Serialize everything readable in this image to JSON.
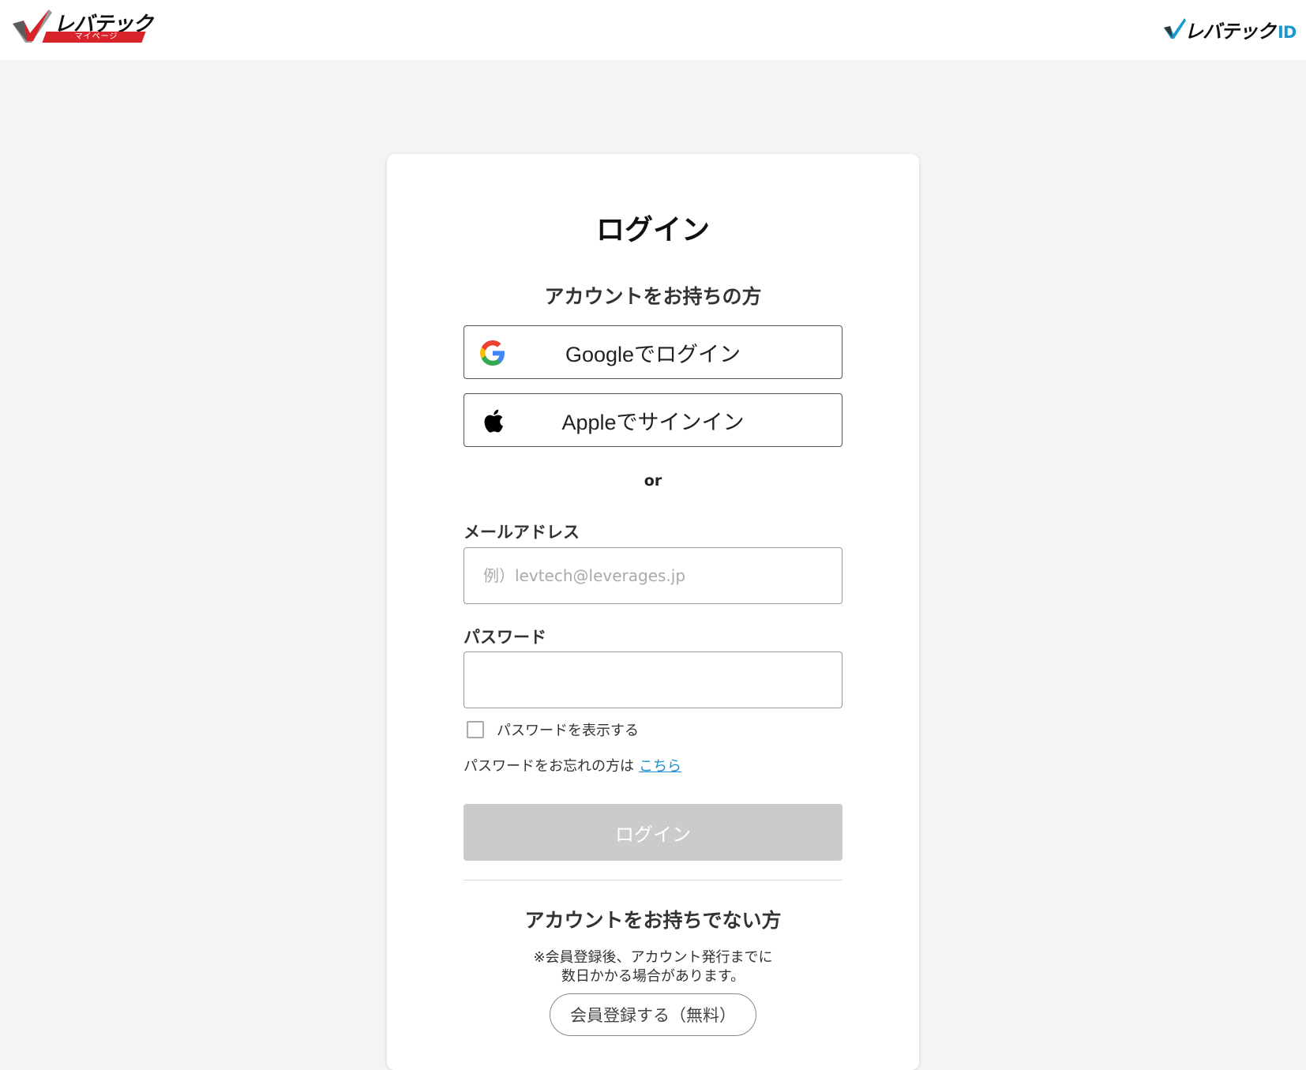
{
  "header": {
    "left_logo": {
      "wordmark": "レバテック",
      "band_text": "マイページ",
      "accent_color": "#d9232a"
    },
    "right_logo": {
      "wordmark": "レバテック",
      "suffix": "ID",
      "accent_color": "#1a9bd0"
    }
  },
  "login": {
    "title": "ログイン",
    "existing_heading": "アカウントをお持ちの方",
    "google_label": "Googleでログイン",
    "google_icon": "google-g-icon",
    "apple_label": "Appleでサインイン",
    "apple_icon": "apple-icon",
    "or": "or",
    "email": {
      "label": "メールアドレス",
      "placeholder": "例）levtech@leverages.jp",
      "value": ""
    },
    "password": {
      "label": "パスワード",
      "value": ""
    },
    "show_password_label": "パスワードを表示する",
    "show_password_checked": false,
    "forgot_text": "パスワードをお忘れの方は",
    "forgot_link": "こちら",
    "submit_label": "ログイン",
    "submit_disabled": true
  },
  "register": {
    "heading": "アカウントをお持ちでない方",
    "note_line1": "※会員登録後、アカウント発行までに",
    "note_line2": "数日かかる場合があります。",
    "button_label": "会員登録する（無料）"
  },
  "colors": {
    "page_bg": "#f4f4f4",
    "card_bg": "#ffffff",
    "link": "#1a8fd0",
    "disabled_button": "#cbcbcb"
  }
}
